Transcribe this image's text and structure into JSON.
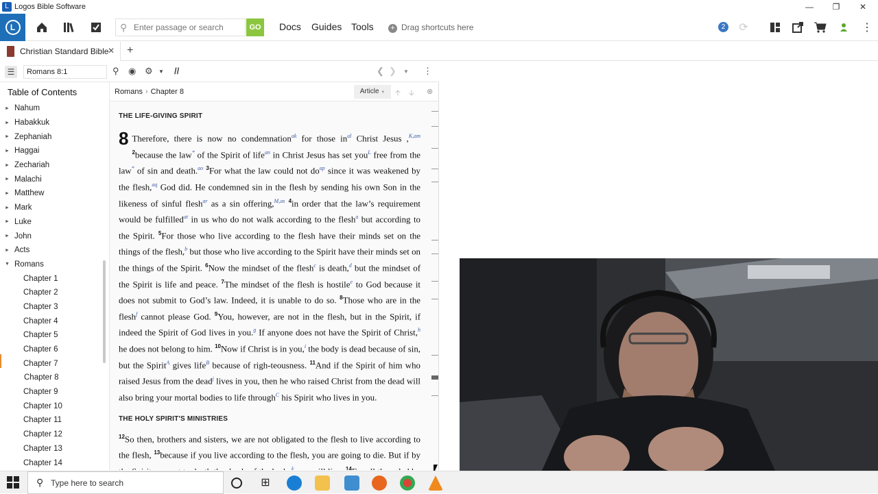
{
  "window": {
    "title": "Logos Bible Software"
  },
  "toolbar": {
    "search_placeholder": "Enter passage or search",
    "go_label": "GO",
    "links": [
      "Docs",
      "Guides",
      "Tools"
    ],
    "drag_shortcuts": "Drag shortcuts here",
    "notification_count": "2"
  },
  "tab": {
    "label": "Christian Standard Bible",
    "add": "+"
  },
  "panel": {
    "reference": "Romans 8:1",
    "parallel": "//"
  },
  "toc": {
    "title": "Table of Contents",
    "books": [
      "Nahum",
      "Habakkuk",
      "Zephaniah",
      "Haggai",
      "Zechariah",
      "Malachi",
      "Matthew",
      "Mark",
      "Luke",
      "John",
      "Acts",
      "Romans"
    ],
    "chapters": [
      "Chapter 1",
      "Chapter 2",
      "Chapter 3",
      "Chapter 4",
      "Chapter 5",
      "Chapter 6",
      "Chapter 7",
      "Chapter 8",
      "Chapter 9",
      "Chapter 10",
      "Chapter 11",
      "Chapter 12",
      "Chapter 13",
      "Chapter 14"
    ],
    "selected_chapter": "Chapter 8"
  },
  "reader": {
    "crumb_book": "Romans",
    "crumb_chapter": "Chapter 8",
    "view_mode": "Article",
    "heading1": "THE LIFE-GIVING SPIRIT",
    "chapter_number": "8",
    "heading2": "THE HOLY SPIRIT'S MINISTRIES"
  },
  "taskbar": {
    "search_placeholder": "Type here to search"
  },
  "colors": {
    "brand_blue": "#1e6fb8",
    "go_green": "#8cc63f",
    "selection_orange": "#e88a2e"
  }
}
